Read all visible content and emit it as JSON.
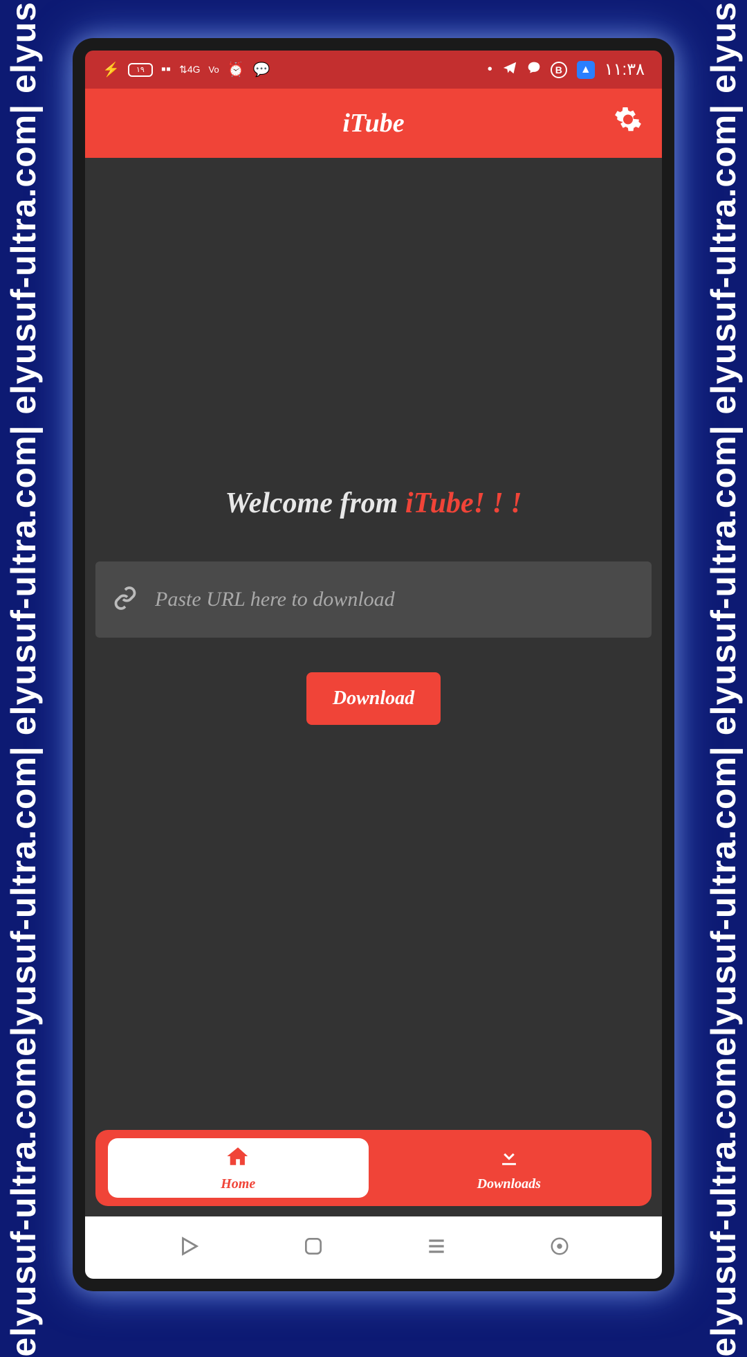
{
  "watermark": "elyusuf-ultra.comelyusuf-ultra.com| elyusuf-ultra.com| elyusuf-ultra.com| elyusuf-ultra.",
  "status_bar": {
    "time": "١١:٣٨",
    "battery_text": "١٩"
  },
  "header": {
    "title": "iTube"
  },
  "main": {
    "welcome_prefix": "Welcome from ",
    "welcome_brand": "iTube! ! !",
    "url_placeholder": "Paste URL here to download",
    "download_label": "Download"
  },
  "nav": {
    "home_label": "Home",
    "downloads_label": "Downloads"
  }
}
